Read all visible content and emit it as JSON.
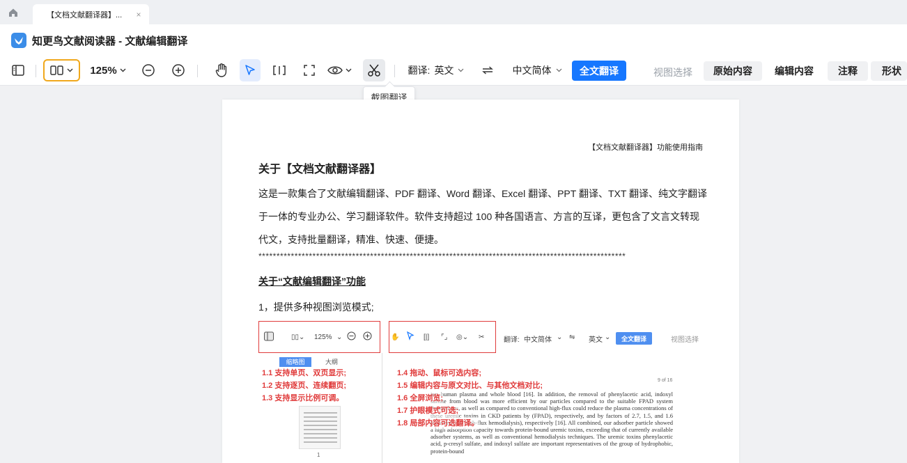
{
  "tabs": {
    "doc_tab_title": "【文档文献翻译器】..."
  },
  "app": {
    "title": "知更鸟文献阅读器 - 文献编辑翻译"
  },
  "toolbar": {
    "zoom": "125%",
    "translate_label": "翻译:",
    "source_lang": "英文",
    "target_lang": "中文简体",
    "full_translate": "全文翻译",
    "view_select": "视图选择",
    "view_tabs": [
      "原始内容",
      "编辑内容",
      "注释",
      "形状"
    ],
    "active_view_tab": "编辑内容"
  },
  "tooltip": "截图翻译",
  "page": {
    "header_note": "【文档文献翻译器】功能使用指南",
    "title": "关于【文档文献翻译器】",
    "paragraph": "这是一款集合了文献编辑翻译、PDF 翻译、Word 翻译、Excel 翻译、PPT 翻译、TXT 翻译、纯文字翻译于一体的专业办公、学习翻译软件。软件支持超过 100 种各国语言、方言的互译，更包含了文言文转现代文，支持批量翻译，精准、快速、便捷。",
    "stars": "******************************************************************************************************",
    "section_title": "关于“文献编辑翻译”功能",
    "subheading": "1，提供多种视图浏览模式;"
  },
  "figure": {
    "zoom": "125%",
    "translate_label": "翻译:",
    "source_lang": "中文简体",
    "target_lang": "英文",
    "full_translate": "全文翻译",
    "view_select": "视图选择",
    "thumb_tab": "缩略图",
    "outline_tab": "大纲",
    "thumb_page_num": "1",
    "page_count": "9 of 16",
    "annotations_left": [
      "1.1 支持单页、双页显示;",
      "1.2 支持逐页、连续翻页;",
      "1.3 支持显示比例可调。"
    ],
    "annotations_right": [
      "1.4 拖动、鼠标可选内容;",
      "1.5 编辑内容与原文对比、与其他文档对比;",
      "1.6 全屏浏览;",
      "1.7 护眼模式可选;",
      "1.8 局部内容可选翻译。"
    ],
    "body_text": "ion human plasma and whole blood [16]. In addition, the removal of phenylacetic acid, indoxyl sulfate from blood was more efficient by our particles compared to the suitable FPAD system Prometheus, as well as compared to conventional high-flux could reduce the plasma concentrations of these uremic toxins in CKD patients by (FPAD), respectively, and by factors of 2.7, 1.5, and 1.6 (conventional high-flux hemodialysis), respectively [16]. All combined, our adsorber particle showed a high adsorption capacity towards protein-bound uremic toxins, exceeding that of currently available adsorber systems, as well as conventional hemodialysis techniques. The uremic toxins phenylacetic acid, p-cresyl sulfate, and indoxyl sulfate are important representatives of the group of hydrophobic, protein-bound"
  },
  "colors": {
    "accent": "#1677ff",
    "highlight_border": "#f0a81c",
    "annotation_red": "#e03b3b"
  }
}
